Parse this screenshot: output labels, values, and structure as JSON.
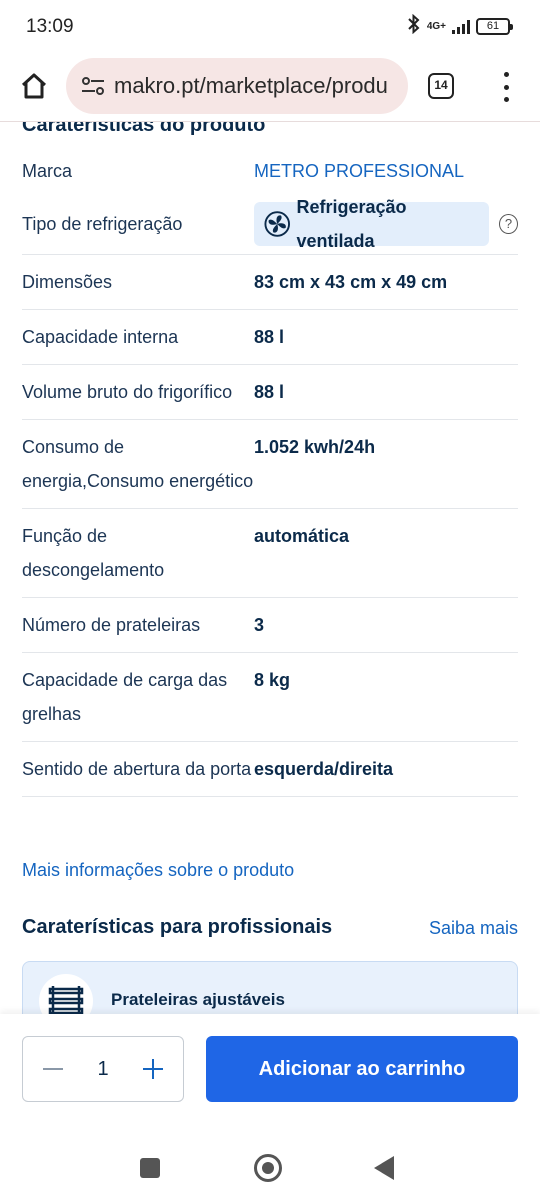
{
  "status_bar": {
    "time": "13:09",
    "network": "4G+",
    "battery": "61",
    "icons": [
      "bluetooth-icon",
      "signal-icon",
      "battery-icon"
    ]
  },
  "browser": {
    "url": "makro.pt/marketplace/produ",
    "tab_count": "14",
    "icons": [
      "home-icon",
      "site-settings-icon",
      "tabs-icon",
      "more-vert-icon"
    ]
  },
  "product_characteristics": {
    "title": "Caraterísticas do produto",
    "rows": [
      {
        "key": "Marca",
        "value": "METRO PROFESSIONAL"
      },
      {
        "key": "Tipo de refrigeração",
        "value": "Refrigeração ventilada"
      },
      {
        "key": "Dimensões",
        "value": "83 cm x 43 cm x 49 cm"
      },
      {
        "key": "Capacidade interna",
        "value": "88 l"
      },
      {
        "key": "Volume bruto do frigorífico",
        "value": "88 l"
      },
      {
        "key": "Consumo de energia,Consumo energético",
        "value": "1.052 kwh/24h"
      },
      {
        "key": "Função de descongelamento",
        "value": "automática"
      },
      {
        "key": "Número de prateleiras",
        "value": "3"
      },
      {
        "key": "Capacidade de carga das grelhas",
        "value": "8 kg"
      },
      {
        "key": "Sentido de abertura da porta",
        "value": "esquerda/direita"
      }
    ],
    "more_info_link": "Mais informações sobre o produto"
  },
  "pro_features": {
    "title": "Caraterísticas para profissionais",
    "link": "Saiba mais",
    "card_label": "Prateleiras ajustáveis"
  },
  "cart": {
    "quantity": "1",
    "add_button": "Adicionar ao carrinho"
  },
  "colors": {
    "primary": "#1f66e6",
    "link": "#1565c0",
    "text_dark": "#0b2a4a",
    "chip_bg": "#e3eefb"
  }
}
